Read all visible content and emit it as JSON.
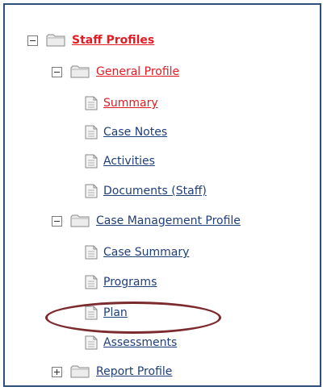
{
  "tree": {
    "root": {
      "label": "Staff Profiles",
      "expander": "minus-icon",
      "icon": "folder-icon"
    },
    "general_profile": {
      "label": "General Profile",
      "expander": "minus-icon",
      "icon": "folder-icon",
      "items": [
        {
          "label": "Summary",
          "active": true,
          "icon": "document-icon"
        },
        {
          "label": "Case Notes",
          "active": false,
          "icon": "document-icon"
        },
        {
          "label": "Activities",
          "active": false,
          "icon": "document-icon"
        },
        {
          "label": "Documents (Staff)",
          "active": false,
          "icon": "document-icon"
        }
      ]
    },
    "case_management_profile": {
      "label": "Case Management Profile",
      "expander": "minus-icon",
      "icon": "folder-icon",
      "items": [
        {
          "label": "Case Summary",
          "icon": "document-icon"
        },
        {
          "label": "Programs",
          "icon": "document-icon"
        },
        {
          "label": "Plan",
          "icon": "document-icon",
          "highlighted": true
        },
        {
          "label": "Assessments",
          "icon": "document-icon"
        }
      ]
    },
    "report_profile": {
      "label": "Report Profile",
      "expander": "plus-icon",
      "icon": "folder-icon"
    }
  },
  "colors": {
    "frame_border": "#2e4f7b",
    "link": "#1f3f7a",
    "active_link": "#e31b23",
    "highlight_oval": "#7b2a2e"
  }
}
